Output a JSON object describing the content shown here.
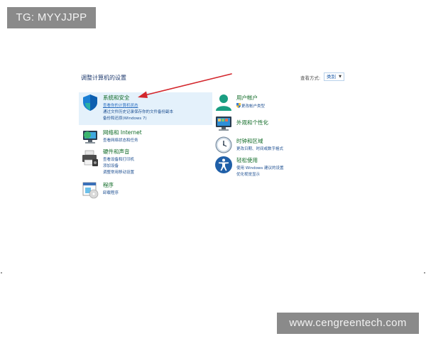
{
  "watermarks": {
    "top_left": "TG: MYYJJPP",
    "bottom_right": "www.cengreentech.com"
  },
  "header": {
    "title": "调整计算机的设置",
    "view_by_label": "查看方式:",
    "view_by_value": "类别"
  },
  "categories": [
    {
      "title": "系统和安全",
      "icon": "shield-icon",
      "links": [
        "查看你的计算机状态",
        "通过文件历史记录保存你的文件备份副本",
        "备份和还原(Windows 7)"
      ]
    },
    {
      "title": "网络和 Internet",
      "icon": "network-icon",
      "links": [
        "查看网络状态和任务"
      ]
    },
    {
      "title": "硬件和声音",
      "icon": "printer-icon",
      "links": [
        "查看设备和打印机",
        "添加设备",
        "调整常用移动设置"
      ]
    },
    {
      "title": "程序",
      "icon": "programs-icon",
      "links": [
        "卸载程序"
      ]
    },
    {
      "title": "用户帐户",
      "icon": "user-accounts-icon",
      "links": [
        "更改帐户类型"
      ]
    },
    {
      "title": "外观和个性化",
      "icon": "appearance-icon",
      "links": []
    },
    {
      "title": "时钟和区域",
      "icon": "clock-icon",
      "links": [
        "更改日期、时间或数字格式"
      ]
    },
    {
      "title": "轻松使用",
      "icon": "ease-of-access-icon",
      "links": [
        "使用 Windows 建议的设置",
        "优化视觉显示"
      ]
    }
  ],
  "colors": {
    "highlight": "#e4f1fb",
    "title_green": "#0f6a26",
    "link_blue": "#1d4f91",
    "arrow_red": "#d3262c"
  }
}
